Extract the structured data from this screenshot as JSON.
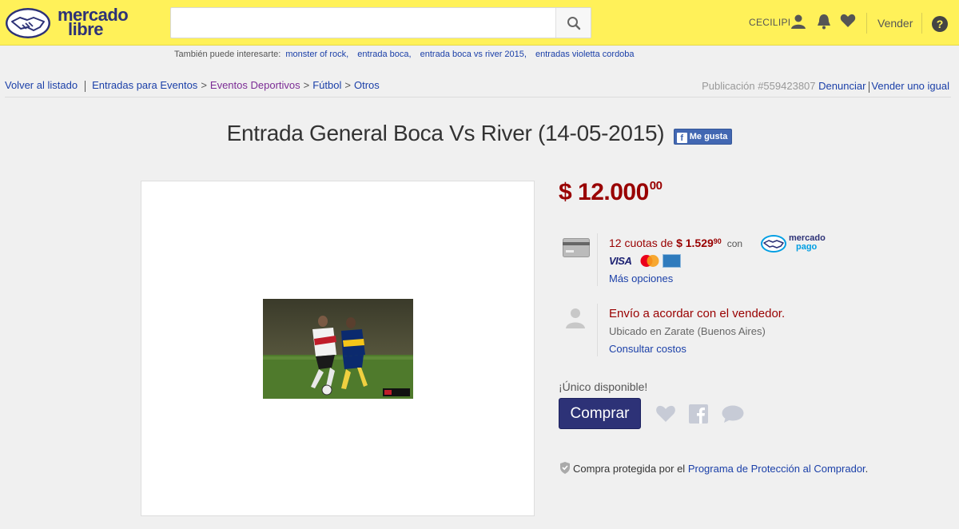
{
  "header": {
    "logo_line1": "mercado",
    "logo_line2": "libre",
    "search_placeholder": "",
    "user_name": "CECILIPI",
    "sell_label": "Vender",
    "help_label": "?"
  },
  "related": {
    "label": "También puede interesarte:",
    "links": [
      "monster of rock,",
      "entrada boca,",
      "entrada boca vs river 2015,",
      "entradas violetta cordoba"
    ]
  },
  "breadcrumb": {
    "back": "Volver al listado",
    "items": [
      "Entradas para Eventos",
      "Eventos Deportivos",
      "Fútbol",
      "Otros"
    ]
  },
  "publication": {
    "number": "Publicación #559423807",
    "report": "Denunciar",
    "sell_same": "Vender uno igual"
  },
  "product": {
    "title": "Entrada General Boca Vs River (14-05-2015)",
    "fb_like": "Me gusta",
    "currency": "$",
    "price_int": "12.000",
    "price_dec": "00"
  },
  "payment": {
    "installments_prefix": "12 cuotas de",
    "installment_amount": "$ 1.529",
    "installment_dec": "90",
    "with": "con",
    "mp_line1": "mercado",
    "mp_line2": "pago",
    "visa": "VISA",
    "more_options": "Más opciones"
  },
  "shipping": {
    "title": "Envío a acordar con el vendedor.",
    "location": "Ubicado en Zarate (Buenos Aires)",
    "costs_link": "Consultar costos"
  },
  "purchase": {
    "availability": "¡Único disponible!",
    "buy_label": "Comprar",
    "protected_prefix": "Compra protegida por el",
    "protected_link": "Programa de Protección al Comprador",
    "protected_suffix": "."
  },
  "colors": {
    "header_yellow": "#fff159",
    "price_red": "#990000",
    "brand_blue": "#2d3277",
    "link_blue": "#1a3fa8"
  }
}
